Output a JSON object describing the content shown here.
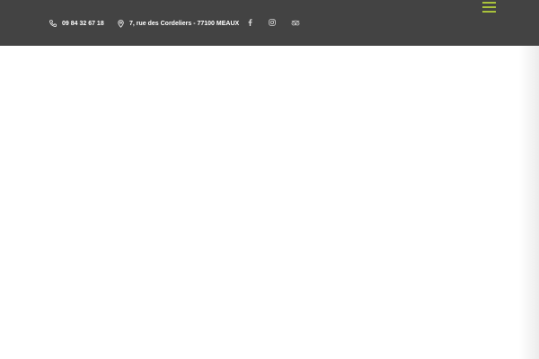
{
  "header": {
    "phone": {
      "icon": "phone-icon",
      "text": "09 84 32 67 18"
    },
    "address": {
      "icon": "map-pin-icon",
      "text": "7, rue des Cordeliers - 77100 MEAUX"
    },
    "social": [
      {
        "icon": "facebook-icon"
      },
      {
        "icon": "instagram-icon"
      },
      {
        "icon": "tripadvisor-icon"
      }
    ],
    "menu": {
      "icon": "hamburger-menu-icon"
    }
  },
  "colors": {
    "topbar_background": "#434343",
    "topbar_text": "#ffffff",
    "accent": "#a9c23b",
    "page_background": "#ffffff"
  }
}
